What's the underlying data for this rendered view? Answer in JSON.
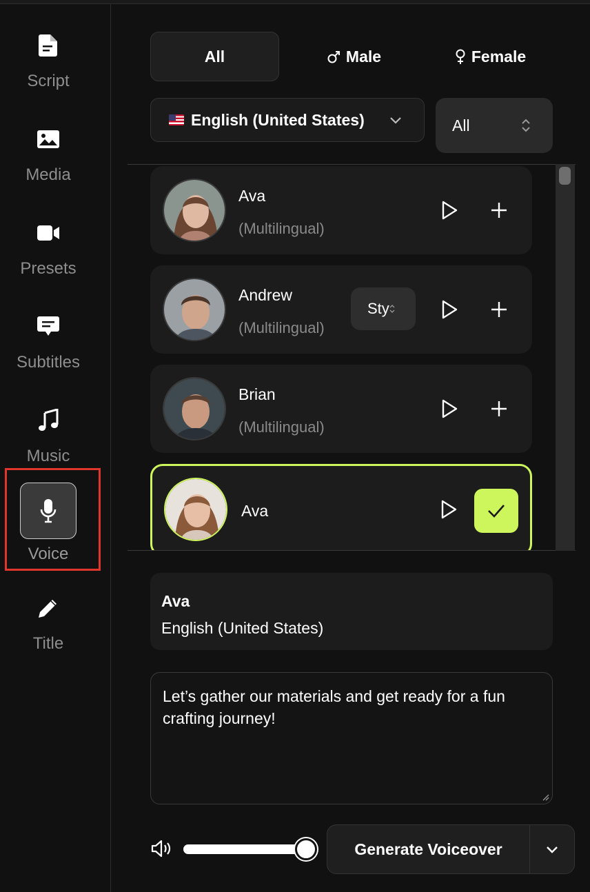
{
  "sidebar": {
    "items": [
      {
        "label": "Script",
        "icon": "document-icon"
      },
      {
        "label": "Media",
        "icon": "image-icon"
      },
      {
        "label": "Presets",
        "icon": "video-camera-icon"
      },
      {
        "label": "Subtitles",
        "icon": "caption-icon"
      },
      {
        "label": "Music",
        "icon": "music-note-icon"
      },
      {
        "label": "Voice",
        "icon": "microphone-icon",
        "active": true
      },
      {
        "label": "Title",
        "icon": "pencil-icon"
      }
    ]
  },
  "filters": {
    "gender_tabs": [
      {
        "label": "All",
        "active": true
      },
      {
        "label": "Male",
        "icon": "male-symbol-icon"
      },
      {
        "label": "Female",
        "icon": "female-symbol-icon"
      }
    ],
    "language": "English (United States)",
    "category": "All"
  },
  "voices": [
    {
      "name": "Ava",
      "subtitle": "(Multilingual)",
      "selected": false
    },
    {
      "name": "Andrew",
      "subtitle": "(Multilingual)",
      "style_label": "Style",
      "selected": false
    },
    {
      "name": "Brian",
      "subtitle": "(Multilingual)",
      "selected": false
    },
    {
      "name": "Ava",
      "selected": true
    }
  ],
  "selected_voice": {
    "name": "Ava",
    "language": "English (United States)"
  },
  "script_text": "Let’s gather our materials and get ready for a fun crafting journey!",
  "volume": 1.0,
  "generate_label": "Generate Voiceover",
  "colors": {
    "accent": "#cdf55c",
    "highlight": "#e0362b",
    "background": "#111111",
    "card": "#1c1c1c"
  }
}
